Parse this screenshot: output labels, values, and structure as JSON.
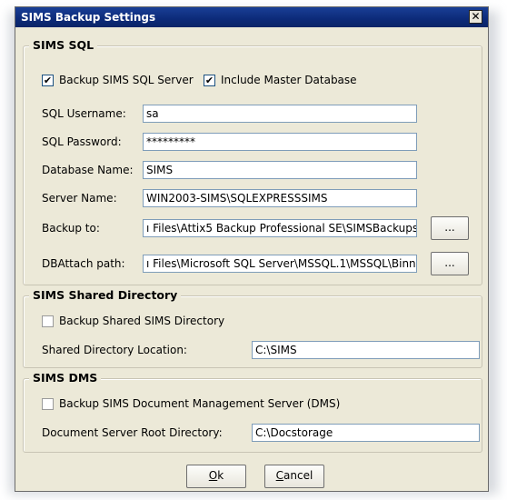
{
  "dialog": {
    "title": "SIMS Backup Settings",
    "close_glyph": "✕"
  },
  "sql": {
    "legend": "SIMS SQL",
    "backup_sql_server": {
      "label": "Backup SIMS SQL Server",
      "checked": true,
      "mark": "✔"
    },
    "include_master": {
      "label": "Include Master Database",
      "checked": true,
      "mark": "✔"
    },
    "username": {
      "label": "SQL Username:",
      "value": "sa"
    },
    "password": {
      "label": "SQL Password:",
      "value": "*********"
    },
    "database_name": {
      "label": "Database Name:",
      "value": "SIMS"
    },
    "server_name": {
      "label": "Server Name:",
      "value": "WIN2003-SIMS\\SQLEXPRESSSIMS"
    },
    "backup_to": {
      "label": "Backup to:",
      "value": "ı Files\\Attix5 Backup Professional SE\\SIMSBackups",
      "browse": "..."
    },
    "dbattach": {
      "label": "DBAttach path:",
      "value": "ı Files\\Microsoft SQL Server\\MSSQL.1\\MSSQL\\Binn",
      "browse": "..."
    }
  },
  "shared": {
    "legend": "SIMS Shared Directory",
    "backup_shared": {
      "label": "Backup Shared SIMS Directory",
      "checked": false
    },
    "location": {
      "label": "Shared Directory Location:",
      "value": "C:\\SIMS"
    }
  },
  "dms": {
    "legend": "SIMS DMS",
    "backup_dms": {
      "label": "Backup SIMS Document Management Server (DMS)",
      "checked": false
    },
    "root": {
      "label": "Document Server Root Directory:",
      "value": "C:\\Docstorage"
    }
  },
  "buttons": {
    "ok": {
      "mnemonic": "O",
      "rest": "k"
    },
    "cancel": {
      "mnemonic": "C",
      "rest": "ancel"
    }
  }
}
